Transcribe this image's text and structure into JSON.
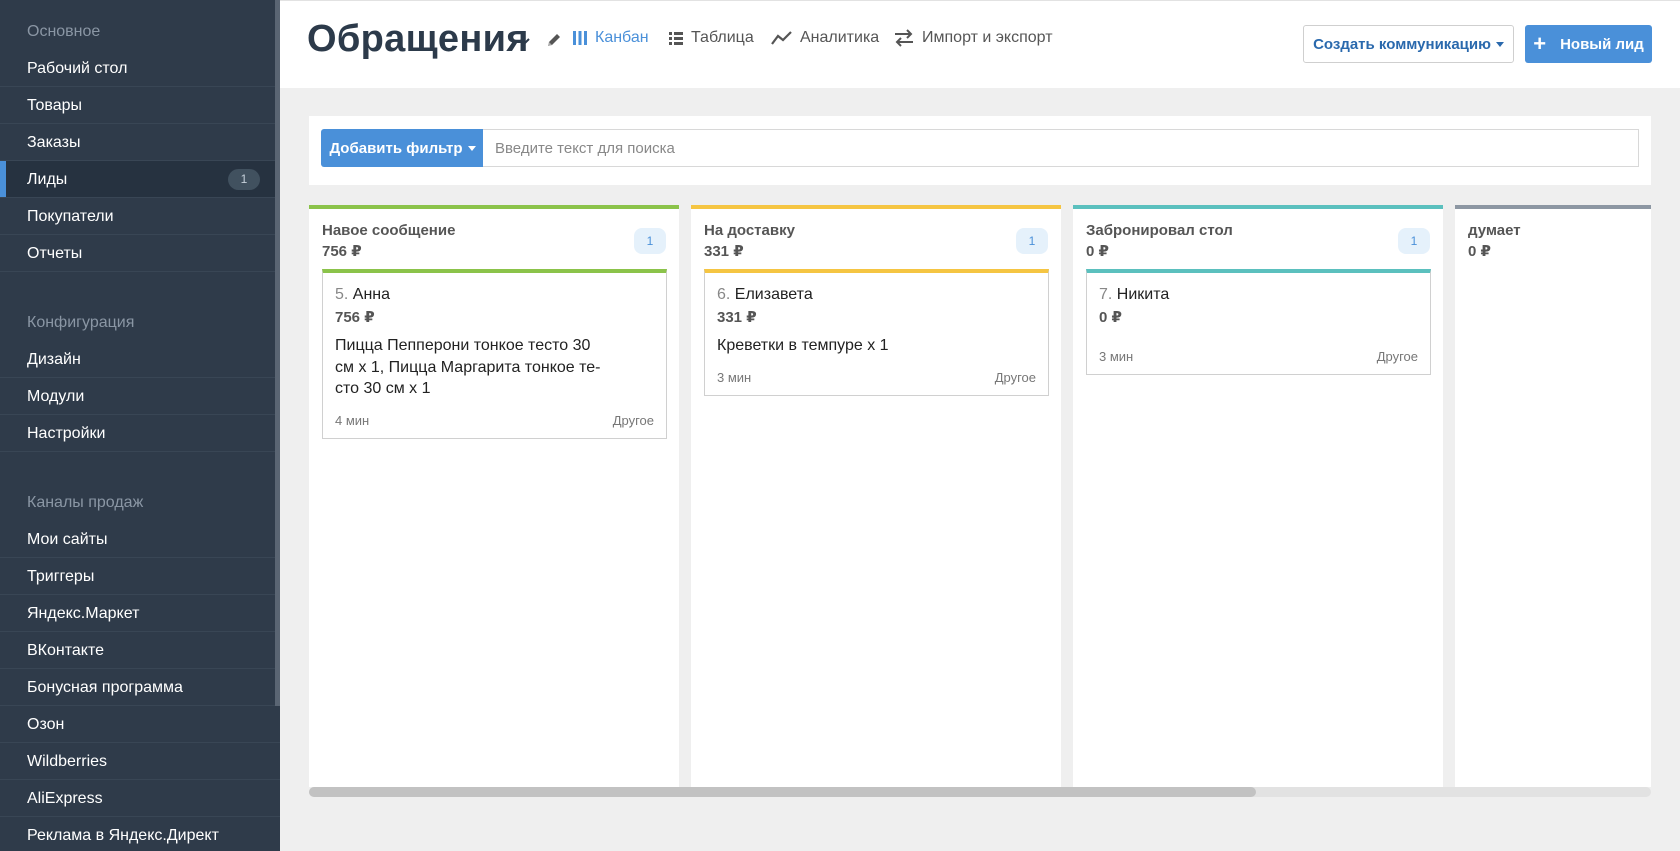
{
  "sidebar": {
    "sections": [
      {
        "title": "Основное",
        "items": [
          {
            "label": "Рабочий стол"
          },
          {
            "label": "Товары"
          },
          {
            "label": "Заказы"
          },
          {
            "label": "Лиды",
            "badge": "1",
            "active": true
          },
          {
            "label": "Покупатели"
          },
          {
            "label": "Отчеты"
          }
        ]
      },
      {
        "title": "Конфигурация",
        "items": [
          {
            "label": "Дизайн"
          },
          {
            "label": "Модули"
          },
          {
            "label": "Настройки"
          }
        ]
      },
      {
        "title": "Каналы продаж",
        "items": [
          {
            "label": "Мои сайты"
          },
          {
            "label": "Триггеры"
          },
          {
            "label": "Яндекс.Маркет"
          },
          {
            "label": "ВКонтакте"
          },
          {
            "label": "Бонусная программа"
          },
          {
            "label": "Озон"
          },
          {
            "label": "Wildberries"
          },
          {
            "label": "AliExpress"
          },
          {
            "label": "Реклама в Яндекс.Директ"
          }
        ]
      }
    ]
  },
  "header": {
    "title": "Обращения",
    "views": {
      "kanban": "Канбан",
      "table": "Таблица",
      "analytics": "Аналитика",
      "import_export": "Импорт и экспорт"
    },
    "create_communication": "Создать коммуникацию",
    "new_lead": "Новый лид"
  },
  "filter": {
    "add_filter": "Добавить фильтр",
    "search_placeholder": "Введите текст для поиска",
    "search_value": ""
  },
  "board": {
    "columns": [
      {
        "title": "Навое сообщение",
        "sum": "756 ₽",
        "count": "1",
        "color": "#8bc34a",
        "cards": [
          {
            "num": "5.",
            "name": "Анна",
            "sum": "756 ₽",
            "description": "Пицца Пепперони тонкое тесто 30 см х 1, Пицца Маргарита тонкое те-сто 30 см х 1",
            "time": "4 мин",
            "source": "Другое"
          }
        ]
      },
      {
        "title": "На доставку",
        "sum": "331 ₽",
        "count": "1",
        "color": "#f5c542",
        "cards": [
          {
            "num": "6.",
            "name": "Елизавета",
            "sum": "331 ₽",
            "description": "Креветки в темпуре х 1",
            "time": "3 мин",
            "source": "Другое"
          }
        ]
      },
      {
        "title": "Забронировал стол",
        "sum": "0 ₽",
        "count": "1",
        "color": "#5bc0be",
        "cards": [
          {
            "num": "7.",
            "name": "Никита",
            "sum": "0 ₽",
            "description": "",
            "time": "3 мин",
            "source": "Другое"
          }
        ]
      },
      {
        "title": "думает",
        "sum": "0 ₽",
        "count": "",
        "color": "#8d97a3",
        "cards": []
      }
    ]
  }
}
